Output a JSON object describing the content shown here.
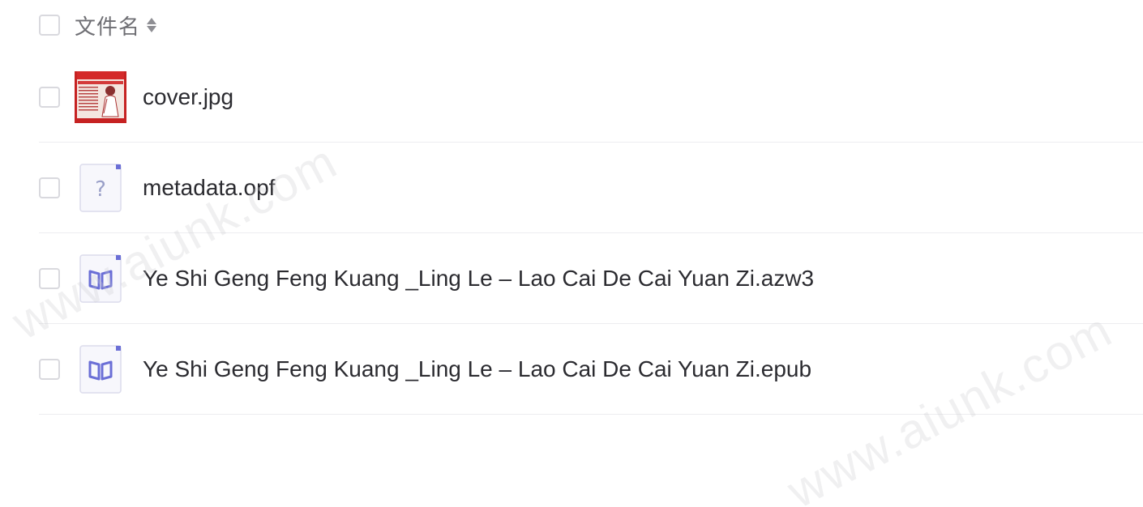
{
  "header": {
    "column_label": "文件名",
    "sort_icon": "sort-up-down-icon"
  },
  "files": [
    {
      "name": "cover.jpg",
      "icon": "image-thumbnail",
      "type": "jpg"
    },
    {
      "name": "metadata.opf",
      "icon": "unknown-file-icon",
      "type": "opf"
    },
    {
      "name": "Ye Shi Geng Feng Kuang _Ling Le – Lao Cai De Cai Yuan Zi.azw3",
      "icon": "book-file-icon",
      "type": "azw3"
    },
    {
      "name": "Ye Shi Geng Feng Kuang _Ling Le – Lao Cai De Cai Yuan Zi.epub",
      "icon": "book-file-icon",
      "type": "epub"
    }
  ],
  "watermarks": [
    "www.aiunk.com",
    "www.aiunk.com"
  ],
  "colors": {
    "text": "#2b2b30",
    "header_text": "#6e6e73",
    "divider": "#ededf0",
    "checkbox_border": "#d9d9de",
    "doc_icon_accent": "#6b6fd6"
  }
}
